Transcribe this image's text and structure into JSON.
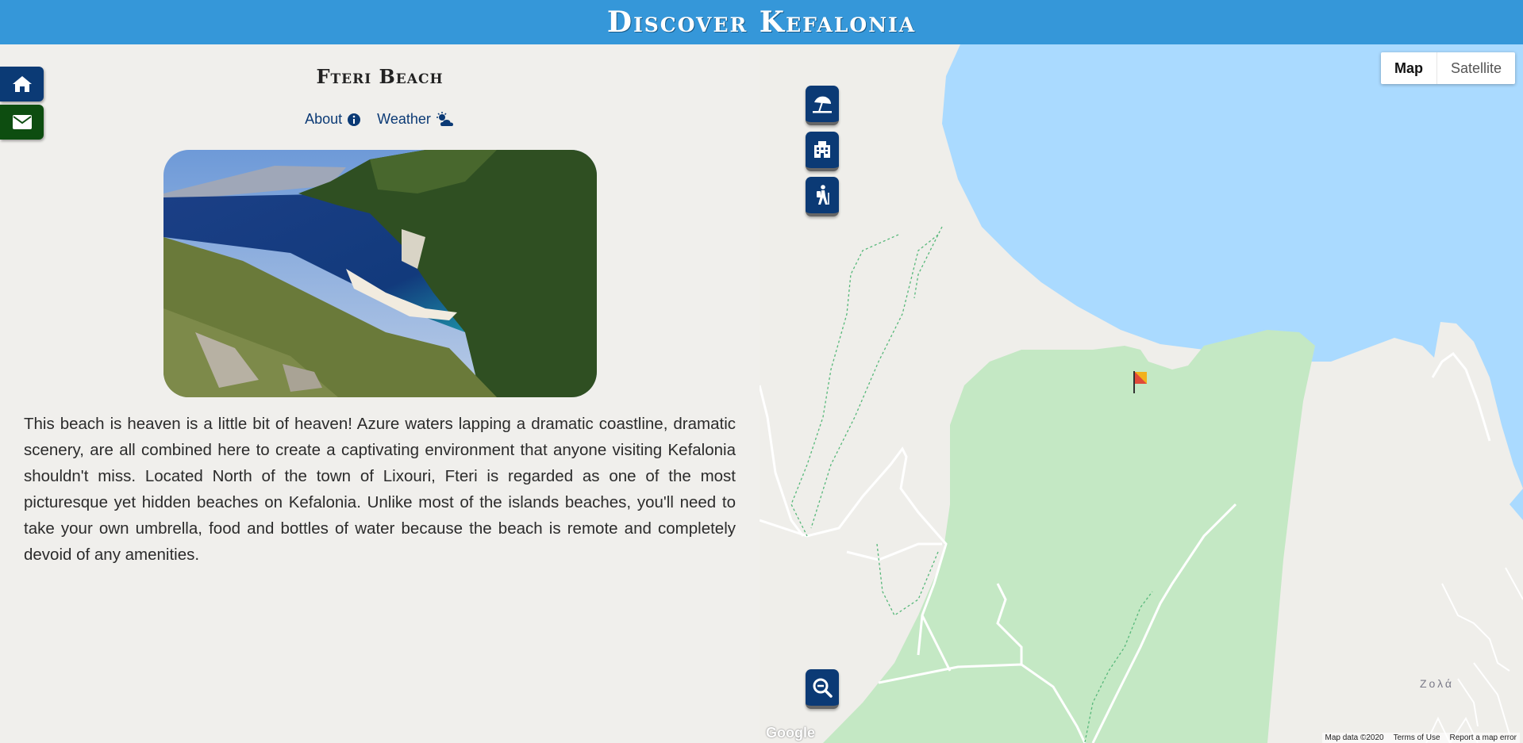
{
  "header": {
    "site_title": "Discover Kefalonia",
    "bg_color": "#3597d9"
  },
  "side_nav": [
    {
      "icon": "home-icon",
      "color": "#0b3a75"
    },
    {
      "icon": "envelope-icon",
      "color": "#0d4d10"
    }
  ],
  "beach": {
    "title": "Fteri Beach",
    "tabs": [
      {
        "label": "About",
        "icon": "info-circle-icon"
      },
      {
        "label": "Weather",
        "icon": "cloud-sun-icon"
      }
    ],
    "description": "This beach is heaven is a little bit of heaven! Azure waters lapping a dramatic coastline, dramatic scenery, are all combined here to create a captivating environment that anyone visiting Kefalonia shouldn't miss. Located North of the town of Lixouri, Fteri is regarded as one of the most picturesque yet hidden beaches on Kefalonia. Unlike most of the islands beaches, you'll need to take your own umbrella, food and bottles of water because the beach is remote and completely devoid of any amenities."
  },
  "map": {
    "type_toggle": {
      "map_label": "Map",
      "satellite_label": "Satellite",
      "selected": "Map"
    },
    "category_buttons": [
      {
        "icon": "beach-umbrella-icon"
      },
      {
        "icon": "building-icon"
      },
      {
        "icon": "hiking-icon"
      }
    ],
    "zoom_out_icon": "zoom-out-icon",
    "marker_icon": "flag-marker-icon",
    "village_label": "Ζολά",
    "google_logo": "Google",
    "footer": {
      "map_data": "Map data ©2020",
      "terms": "Terms of Use",
      "report": "Report a map error"
    },
    "colors": {
      "sea": "#aadaff",
      "land": "#efeeea",
      "park": "#c4e8c4"
    }
  }
}
